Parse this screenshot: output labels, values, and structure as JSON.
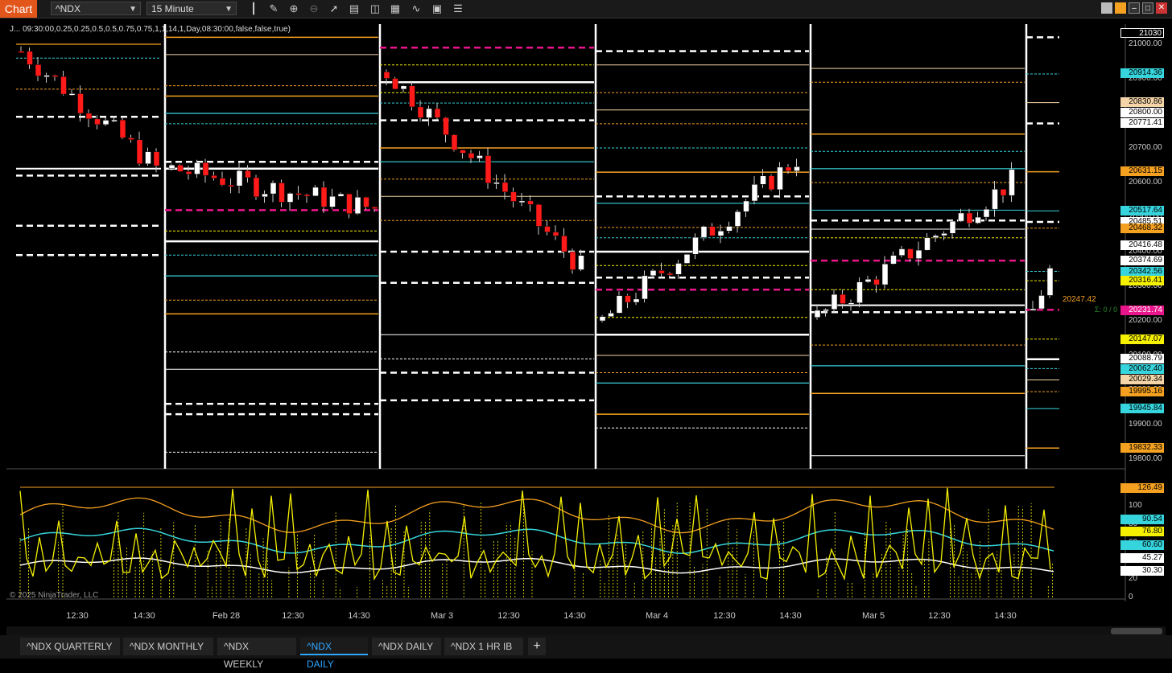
{
  "app": {
    "title": "Chart"
  },
  "toolbar": {
    "instrument": "^NDX",
    "interval": "15 Minute",
    "icons": [
      "bar-type-icon",
      "draw-pencil-icon",
      "zoom-in-icon",
      "zoom-out-icon",
      "pointer-icon",
      "properties-icon",
      "strategies-icon",
      "indicators-icon",
      "line-tool-icon",
      "data-box-icon",
      "menu-icon"
    ]
  },
  "window_controls": [
    "restore-icon",
    "tile-icon",
    "minimize-icon",
    "maximize-icon",
    "close-icon"
  ],
  "indicator_params": "J... 09:30:00,0.25,0.25,0.5,0.5,0.75,0.75,1,1,14,1,Day,08:30:00,false,false,true)",
  "copyright": "© 2025 NinjaTrader, LLC",
  "price_axis": {
    "ticks": [
      "21000.00",
      "20900.00",
      "20800.00",
      "20700.00",
      "20600.00",
      "20500.00",
      "20400.00",
      "20300.00",
      "20200.00",
      "20100.00",
      "20000.00",
      "19900.00",
      "19800.00"
    ],
    "labels": [
      {
        "text": "21030",
        "color": "#ffffff",
        "bg": "#000000",
        "border": "#ffffff"
      },
      {
        "text": "20914.36",
        "color": "#000000",
        "bg": "#36d4dc"
      },
      {
        "text": "20830.86",
        "color": "#000000",
        "bg": "#f5d5a8"
      },
      {
        "text": "20800.00",
        "color": "#000000",
        "bg": "#ffffff"
      },
      {
        "text": "20771.41",
        "color": "#000000",
        "bg": "#ffffff"
      },
      {
        "text": "20631.15",
        "color": "#000000",
        "bg": "#f4a020"
      },
      {
        "text": "20517.64",
        "color": "#000000",
        "bg": "#36d4dc"
      },
      {
        "text": "20485.51",
        "color": "#000000",
        "bg": "#ffffff"
      },
      {
        "text": "20468.32",
        "color": "#000000",
        "bg": "#f4a020"
      },
      {
        "text": "20416.48",
        "color": "#000000",
        "bg": "#ffffff"
      },
      {
        "text": "20374.69",
        "color": "#000000",
        "bg": "#ffffff"
      },
      {
        "text": "20342.56",
        "color": "#000000",
        "bg": "#36d4dc"
      },
      {
        "text": "20316.41",
        "color": "#000000",
        "bg": "#f5f000"
      },
      {
        "text": "20231.74",
        "color": "#ffffff",
        "bg": "#e8168a"
      },
      {
        "text": "20147.07",
        "color": "#000000",
        "bg": "#f5f000"
      },
      {
        "text": "20088.79",
        "color": "#000000",
        "bg": "#ffffff"
      },
      {
        "text": "20062.40",
        "color": "#000000",
        "bg": "#36d4dc"
      },
      {
        "text": "20029.34",
        "color": "#000000",
        "bg": "#f5d5a8"
      },
      {
        "text": "19995.16",
        "color": "#000000",
        "bg": "#f4a020"
      },
      {
        "text": "19945.84",
        "color": "#000000",
        "bg": "#36d4dc"
      },
      {
        "text": "19832.33",
        "color": "#000000",
        "bg": "#f4a020"
      }
    ],
    "floating_value": "20247.42",
    "sigma_text": "Σ: 0 / 0"
  },
  "indicator_axis": {
    "ticks": [
      "120",
      "100",
      "80",
      "60",
      "40",
      "20",
      "0"
    ],
    "labels": [
      {
        "text": "126.49",
        "color": "#000000",
        "bg": "#f4a020"
      },
      {
        "text": "90.54",
        "color": "#000000",
        "bg": "#36d4dc"
      },
      {
        "text": "76.80",
        "color": "#000000",
        "bg": "#f5f000"
      },
      {
        "text": "60.60",
        "color": "#000000",
        "bg": "#36d4dc"
      },
      {
        "text": "45.27",
        "color": "#000000",
        "bg": "#ffffff"
      },
      {
        "text": "30.30",
        "color": "#000000",
        "bg": "#ffffff"
      }
    ]
  },
  "time_axis": [
    "12:30",
    "14:30",
    "Feb 28",
    "12:30",
    "14:30",
    "Mar 3",
    "12:30",
    "14:30",
    "Mar 4",
    "12:30",
    "14:30",
    "Mar 5",
    "12:30",
    "14:30"
  ],
  "tabs": [
    {
      "label": "^NDX QUARTERLY",
      "active": false
    },
    {
      "label": "^NDX MONTHLY",
      "active": false
    },
    {
      "label": "^NDX WEEKLY",
      "active": false
    },
    {
      "label": "^NDX DAILY",
      "active": true
    },
    {
      "label": "^NDX DAILY",
      "active": false
    },
    {
      "label": "^NDX 1 HR IB",
      "active": false
    }
  ],
  "add_tab_label": "+",
  "colors": {
    "accent": "#e2561c",
    "up": "#ffffff",
    "down": "#ff1a1a",
    "cyan": "#36d4dc",
    "orange": "#f4a020",
    "yellow": "#f5f000",
    "magenta": "#e8168a",
    "tab_active": "#2fa6ff"
  }
}
